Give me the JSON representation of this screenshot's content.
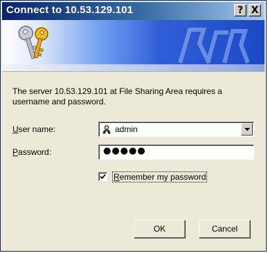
{
  "window": {
    "title": "Connect to 10.53.129.101",
    "help_button": "?",
    "close_button": "X"
  },
  "message": "The server 10.53.129.101 at File Sharing Area requires a username and password.",
  "form": {
    "username_label_prefix": "",
    "username_label_underlined": "U",
    "username_label_rest": "ser name:",
    "username_value": "admin",
    "password_label_underlined": "P",
    "password_label_rest": "assword:",
    "password_masked": "●●●●●",
    "remember_label_underlined": "R",
    "remember_label_rest": "emember my password",
    "remember_checked": true
  },
  "buttons": {
    "ok": "OK",
    "cancel": "Cancel"
  },
  "colors": {
    "title_gradient_start": "#0a246a",
    "banner_accent": "#1c48c4",
    "dialog_bg": "#ece9d8"
  },
  "icons": {
    "banner": "keys-icon",
    "username": "user-icon",
    "dropdown": "chevron-down-icon",
    "check": "checkmark-icon"
  }
}
